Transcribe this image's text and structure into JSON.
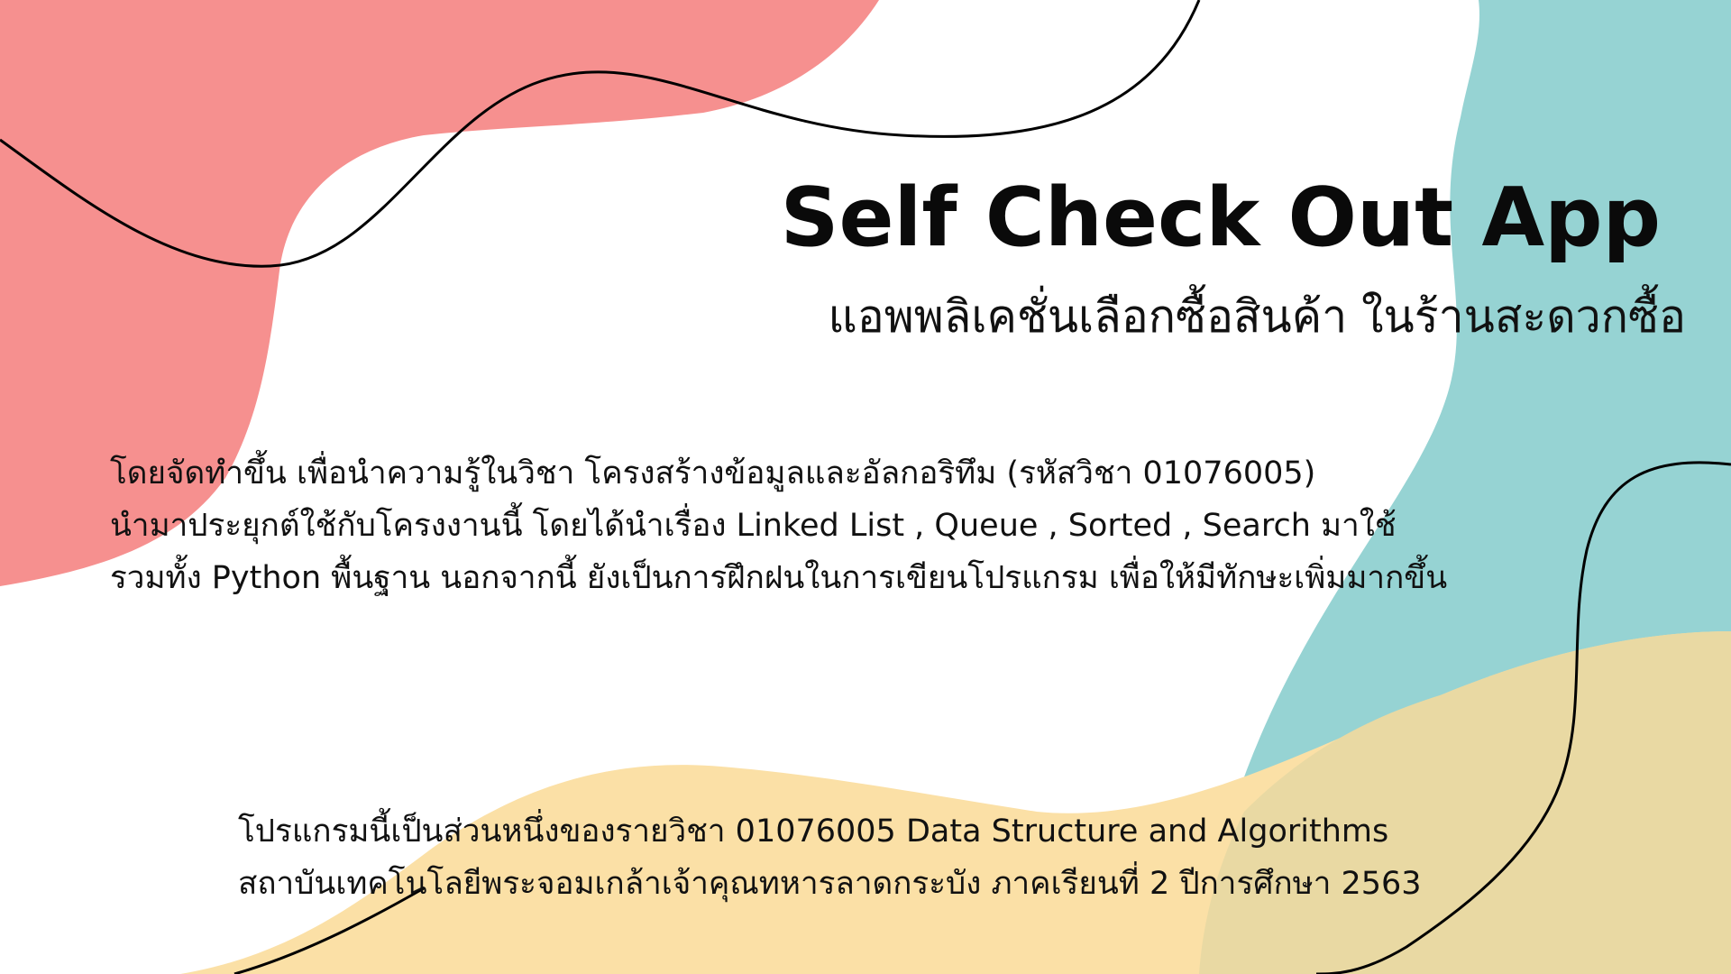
{
  "colors": {
    "background": "#ffffff",
    "coral": "#f6908f",
    "teal": "#96d3d3",
    "sand": "#fbe0a6",
    "olive_sand": "#e9d9a3",
    "line": "#000000",
    "text": "#111111"
  },
  "header": {
    "title": "Self Check Out App",
    "subtitle": "แอพพลิเคชั่นเลือกซื้อสินค้า ในร้านสะดวกซื้อ"
  },
  "intro": {
    "lines": [
      "โดยจัดทำขึ้น เพื่อนำความรู้ในวิชา โครงสร้างข้อมูลและอัลกอริทึม (รหัสวิชา 01076005)",
      "นำมาประยุกต์ใช้กับโครงงานนี้ โดยได้นำเรื่อง Linked List , Queue , Sorted , Search มาใช้",
      "รวมทั้ง Python พื้นฐาน นอกจากนี้ ยังเป็นการฝึกฝนในการเขียนโปรแกรม เพื่อให้มีทักษะเพิ่มมากขึ้น"
    ]
  },
  "course": {
    "lines": [
      "โปรแกรมนี้เป็นส่วนหนึ่งของรายวิชา 01076005 Data Structure and Algorithms",
      "สถาบันเทคโนโลยีพระจอมเกล้าเจ้าคุณทหารลาดกระบัง ภาคเรียนที่ 2 ปีการศึกษา 2563"
    ]
  }
}
